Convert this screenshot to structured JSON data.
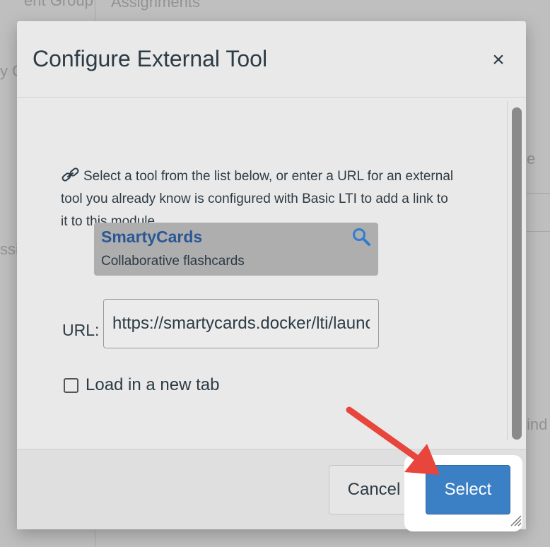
{
  "background": {
    "snippets": [
      "ent Group",
      "Assignments",
      "y C",
      "ssi",
      "e",
      "ind"
    ]
  },
  "dialog": {
    "title": "Configure External Tool",
    "close_symbol": "×",
    "intro_text": "Select a tool from the list below, or enter a URL for an external tool you already know is configured with Basic LTI to add a link to it to this module.",
    "tool": {
      "name": "SmartyCards",
      "description": "Collaborative flashcards"
    },
    "url_label": "URL:",
    "url_value": "https://smartycards.docker/lti/launch",
    "checkbox_label": "Load in a new tab",
    "checkbox_checked": false,
    "cancel_label": "Cancel",
    "select_label": "Select"
  },
  "colors": {
    "primary": "#3b7fc4",
    "tool_name": "#2b5797",
    "annotation_arrow": "#e8453c"
  },
  "icons": [
    "link-icon",
    "search-icon",
    "close-icon",
    "resize-grip-icon",
    "annotation-arrow"
  ]
}
